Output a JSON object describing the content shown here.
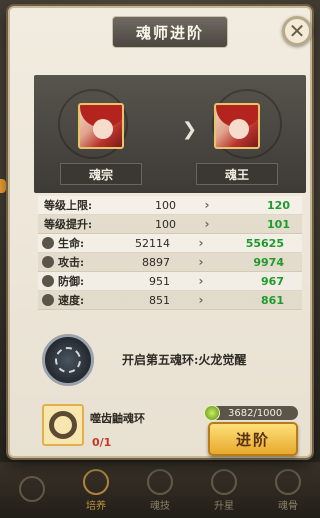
{
  "title": "魂师进阶",
  "close_icon": "close-icon",
  "ranks": {
    "current": "魂宗",
    "next": "魂王"
  },
  "stats": [
    {
      "label": "等级上限:",
      "icon": "",
      "old": "100",
      "new": "120"
    },
    {
      "label": "等级提升:",
      "icon": "",
      "old": "100",
      "new": "101"
    },
    {
      "label": "生命:",
      "icon": "heart-icon",
      "old": "52114",
      "new": "55625"
    },
    {
      "label": "攻击:",
      "icon": "sword-icon",
      "old": "8897",
      "new": "9974"
    },
    {
      "label": "防御:",
      "icon": "shield-icon",
      "old": "951",
      "new": "967"
    },
    {
      "label": "速度:",
      "icon": "boot-icon",
      "old": "851",
      "new": "861"
    }
  ],
  "unlock": {
    "text": "开启第五魂环:火龙觉醒"
  },
  "item": {
    "name": "噬齿鼬魂环",
    "count": "0/1"
  },
  "soul": {
    "value": "3682/1000"
  },
  "advance_button": "进阶",
  "nav": [
    {
      "label": "",
      "icon": "arrow-icon"
    },
    {
      "label": "培养",
      "icon": "upgrade-icon"
    },
    {
      "label": "魂技",
      "icon": "skill-icon"
    },
    {
      "label": "升星",
      "icon": "star-icon"
    },
    {
      "label": "魂骨",
      "icon": "bone-icon"
    }
  ],
  "colors": {
    "stat_up": "#1f9a2c",
    "accent": "#e8a92c",
    "count_red": "#c0392b"
  }
}
